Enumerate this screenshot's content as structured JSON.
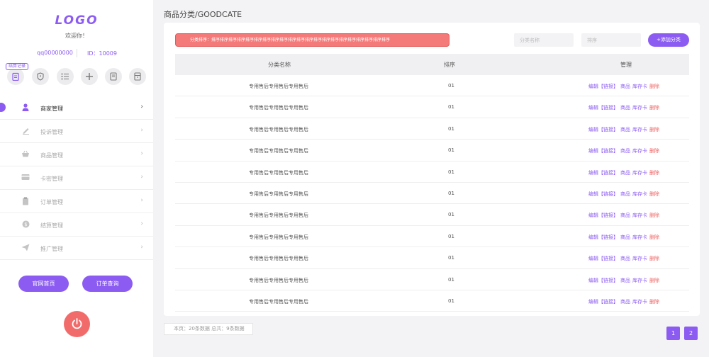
{
  "sidebar": {
    "logo": "LOGO",
    "welcome": "欢迎你！",
    "user_id": "qq00000000",
    "member_id": "ID：10009",
    "quick_badge": "结算记录",
    "quick_icons": [
      "clipboard-icon",
      "shield-icon",
      "list-icon",
      "plus-icon",
      "document-icon",
      "archive-icon"
    ],
    "menu": [
      {
        "label": "商家管理",
        "icon": "user-icon",
        "active": true
      },
      {
        "label": "投诉管理",
        "icon": "pencil-icon",
        "active": false
      },
      {
        "label": "商品管理",
        "icon": "basket-icon",
        "active": false
      },
      {
        "label": "卡密管理",
        "icon": "card-icon",
        "active": false
      },
      {
        "label": "订单管理",
        "icon": "clipboard-icon",
        "active": false
      },
      {
        "label": "结算管理",
        "icon": "coin-icon",
        "active": false
      },
      {
        "label": "推广管理",
        "icon": "send-icon",
        "active": false
      }
    ],
    "home_button": "官网首页",
    "order_button": "订单查询"
  },
  "main": {
    "title": "商品分类/GOODCATE",
    "notice": "分类排序：排序排序排序排序排序排序排序排序排序排序排序排序排序排序排序排序排序排序排序排序排序",
    "name_placeholder": "分类名称",
    "sort_placeholder": "排序",
    "add_button": "+添加分类",
    "table": {
      "headers": [
        "分类名称",
        "排序",
        "管理"
      ],
      "rows": [
        {
          "name": "专用售后专用售后专用售后",
          "sort": "01"
        },
        {
          "name": "专用售后专用售后专用售后",
          "sort": "01"
        },
        {
          "name": "专用售后专用售后专用售后",
          "sort": "01"
        },
        {
          "name": "专用售后专用售后专用售后",
          "sort": "01"
        },
        {
          "name": "专用售后专用售后专用售后",
          "sort": "01"
        },
        {
          "name": "专用售后专用售后专用售后",
          "sort": "01"
        },
        {
          "name": "专用售后专用售后专用售后",
          "sort": "01"
        },
        {
          "name": "专用售后专用售后专用售后",
          "sort": "01"
        },
        {
          "name": "专用售后专用售后专用售后",
          "sort": "01"
        },
        {
          "name": "专用售后专用售后专用售后",
          "sort": "01"
        },
        {
          "name": "专用售后专用售后专用售后",
          "sort": "01"
        }
      ],
      "ops": {
        "edit": "编辑【链接】",
        "goods": "商品",
        "stock": "库存卡",
        "delete": "删除"
      }
    },
    "footer_info": "本页：20条数据  总共：9条数据",
    "pages": [
      "1",
      "2"
    ]
  },
  "colors": {
    "accent": "#8c5cf2",
    "danger": "#f26b6b"
  }
}
